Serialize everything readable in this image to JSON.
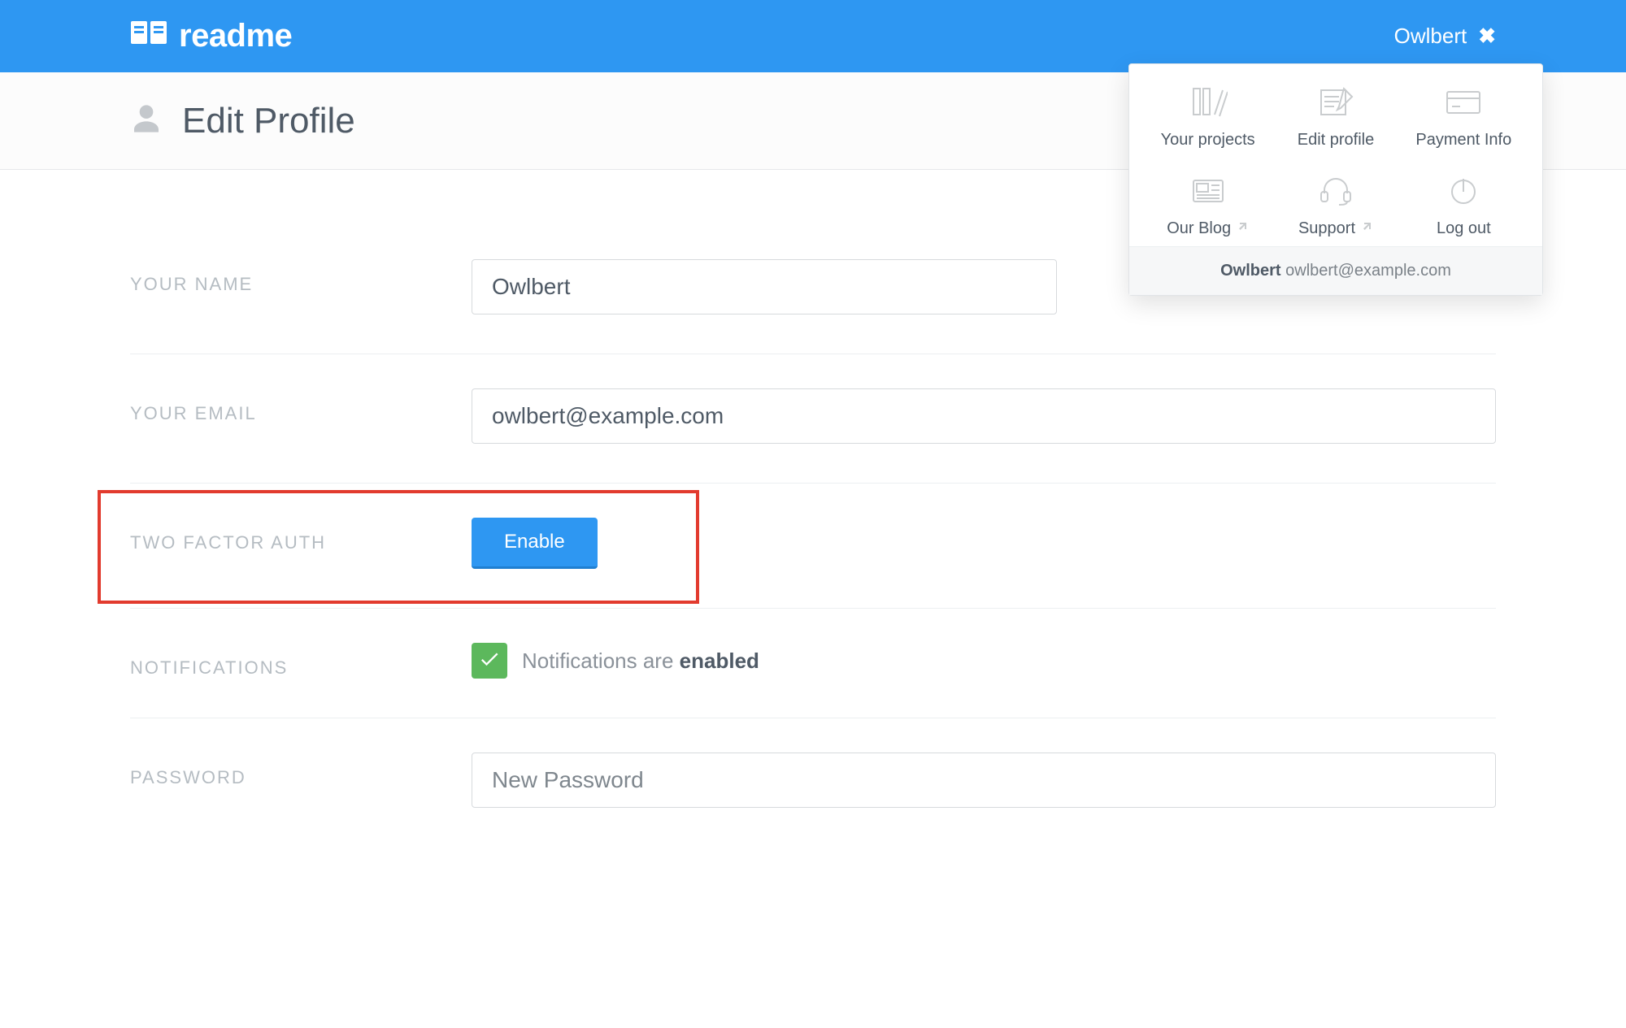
{
  "brand": "readme",
  "topbar": {
    "username": "Owlbert"
  },
  "page_title": "Edit Profile",
  "form": {
    "name_label": "YOUR NAME",
    "name_value": "Owlbert",
    "email_label": "YOUR EMAIL",
    "email_value": "owlbert@example.com",
    "tfa_label": "TWO FACTOR AUTH",
    "tfa_button": "Enable",
    "notifications_label": "NOTIFICATIONS",
    "notifications_prefix": "Notifications are ",
    "notifications_state": "enabled",
    "password_label": "PASSWORD",
    "password_placeholder": "New Password"
  },
  "dropdown": {
    "items": [
      {
        "label": "Your projects"
      },
      {
        "label": "Edit profile"
      },
      {
        "label": "Payment Info"
      },
      {
        "label": "Our Blog",
        "external": true
      },
      {
        "label": "Support",
        "external": true
      },
      {
        "label": "Log out"
      }
    ],
    "footer_name": "Owlbert",
    "footer_email": "owlbert@example.com"
  }
}
